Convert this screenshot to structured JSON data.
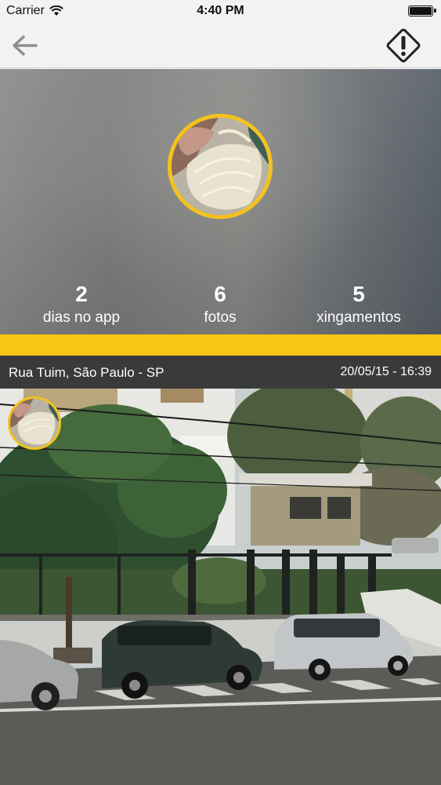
{
  "status_bar": {
    "carrier": "Carrier",
    "time": "4:40 PM",
    "icons": [
      "wifi-icon",
      "battery-icon"
    ]
  },
  "nav": {
    "back_icon": "arrow-left-icon",
    "report_icon": "warning-diamond-icon"
  },
  "profile": {
    "accent_color": "#f4c21d",
    "stats": [
      {
        "value": "2",
        "label": "dias no app"
      },
      {
        "value": "6",
        "label": "fotos"
      },
      {
        "value": "5",
        "label": "xingamentos"
      }
    ]
  },
  "post": {
    "location": "Rua Tuim, São Paulo - SP",
    "datetime": "20/05/15 - 16:39"
  },
  "colors": {
    "yellow_bar": "#f8c415",
    "post_header_bg": "#3a3a3a"
  }
}
